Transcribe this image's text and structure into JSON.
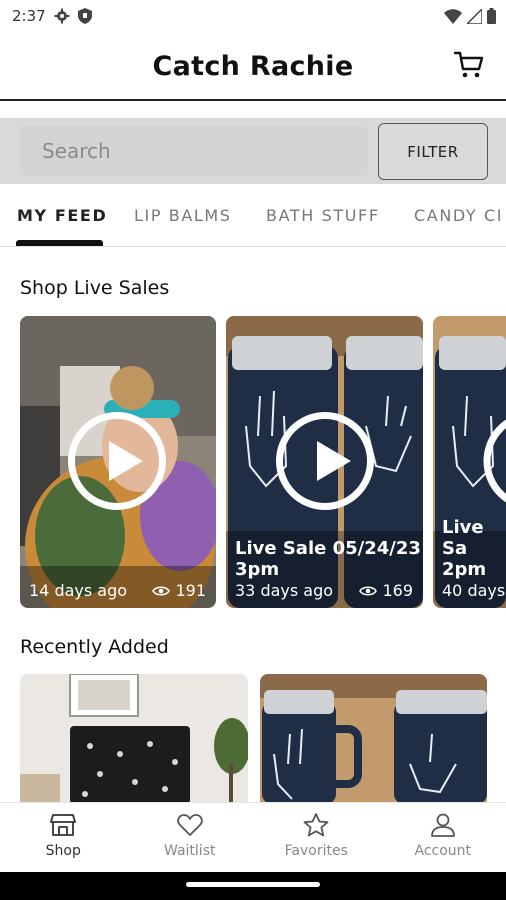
{
  "status_bar": {
    "time": "2:37"
  },
  "header": {
    "title": "Catch Rachie"
  },
  "search": {
    "placeholder": "Search",
    "filter_label": "FILTER"
  },
  "tabs": [
    {
      "label": "MY FEED"
    },
    {
      "label": "LIP BALMS"
    },
    {
      "label": "BATH STUFF"
    },
    {
      "label": "CANDY CI"
    }
  ],
  "live_section": {
    "title": "Shop Live Sales",
    "cards": [
      {
        "caption": "",
        "ago": "14 days ago",
        "views": "191"
      },
      {
        "caption": "Live Sale 05/24/23 3pm",
        "ago": "33 days ago",
        "views": "169"
      },
      {
        "caption": "Live Sa 2pm",
        "ago": "40 days",
        "views": ""
      }
    ]
  },
  "recent_section": {
    "title": "Recently Added"
  },
  "bottom_nav": [
    {
      "label": "Shop",
      "icon": "shop-icon"
    },
    {
      "label": "Waitlist",
      "icon": "heart-icon"
    },
    {
      "label": "Favorites",
      "icon": "star-icon"
    },
    {
      "label": "Account",
      "icon": "person-icon"
    }
  ]
}
